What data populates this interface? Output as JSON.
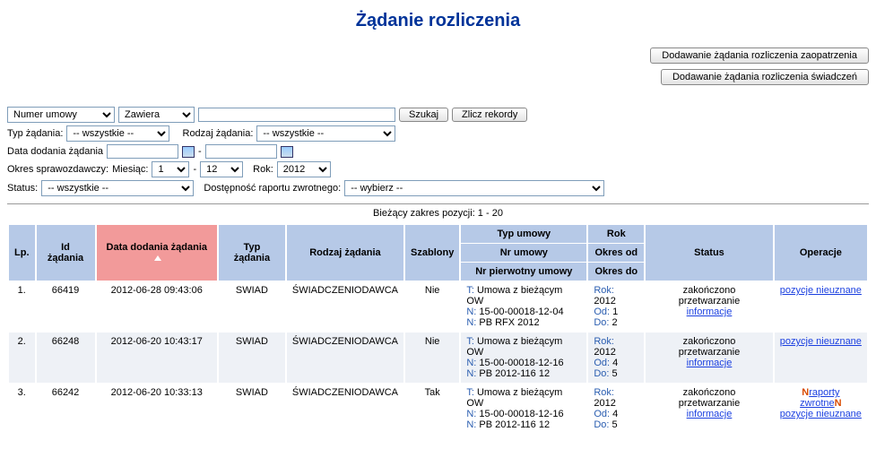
{
  "title": "Żądanie rozliczenia",
  "buttons": {
    "add_supply": "Dodawanie żądania rozliczenia zaopatrzenia",
    "add_service": "Dodawanie żądania rozliczenia świadczeń",
    "search": "Szukaj",
    "count": "Zlicz rekordy"
  },
  "filters": {
    "field_selector": "Numer umowy",
    "match_selector": "Zawiera",
    "search_value": "",
    "type_label": "Typ żądania:",
    "type_value": "-- wszystkie --",
    "kind_label": "Rodzaj żądania:",
    "kind_value": "-- wszystkie --",
    "date_added_label": "Data dodania żądania",
    "date_from": "",
    "date_to": "",
    "period_label": "Okres sprawozdawczy:",
    "month_label": "Miesiąc:",
    "month_from": "1",
    "month_to": "12",
    "year_label": "Rok:",
    "year_value": "2012",
    "status_label": "Status:",
    "status_value": "-- wszystkie --",
    "report_avail_label": "Dostępność raportu zwrotnego:",
    "report_avail_value": "-- wybierz --"
  },
  "range_text": "Bieżący zakres pozycji: 1 - 20",
  "headers": {
    "lp": "Lp.",
    "id": "Id żądania",
    "date_added": "Data dodania żądania",
    "type": "Typ żądania",
    "kind": "Rodzaj żądania",
    "templates": "Szablony",
    "agr_type": "Typ umowy",
    "agr_no": "Nr umowy",
    "agr_primary": "Nr pierwotny umowy",
    "year": "Rok",
    "period_from": "Okres od",
    "period_to": "Okres do",
    "status": "Status",
    "ops": "Operacje"
  },
  "labels": {
    "T": "T:",
    "N": "N:",
    "Rok": "Rok:",
    "Od": "Od:",
    "Do": "Do:"
  },
  "rows": [
    {
      "lp": "1.",
      "id": "66419",
      "date": "2012-06-28 09:43:06",
      "type": "SWIAD",
      "kind": "ŚWIADCZENIODAWCA",
      "templates": "Nie",
      "agr_t": "Umowa z bieżącym OW",
      "agr_n1": "15-00-00018-12-04",
      "agr_n2": "PB RFX 2012",
      "rok": "2012",
      "od": "1",
      "do": "2",
      "status1": "zakończono przetwarzanie",
      "status_link": "informacje",
      "ops": [
        {
          "text": "pozycje nieuznane",
          "new": false
        }
      ]
    },
    {
      "lp": "2.",
      "id": "66248",
      "date": "2012-06-20 10:43:17",
      "type": "SWIAD",
      "kind": "ŚWIADCZENIODAWCA",
      "templates": "Nie",
      "agr_t": "Umowa z bieżącym OW",
      "agr_n1": "15-00-00018-12-16",
      "agr_n2": "PB 2012-116 12",
      "rok": "2012",
      "od": "4",
      "do": "5",
      "status1": "zakończono przetwarzanie",
      "status_link": "informacje",
      "ops": [
        {
          "text": "pozycje nieuznane",
          "new": false
        }
      ]
    },
    {
      "lp": "3.",
      "id": "66242",
      "date": "2012-06-20 10:33:13",
      "type": "SWIAD",
      "kind": "ŚWIADCZENIODAWCA",
      "templates": "Tak",
      "agr_t": "Umowa z bieżącym OW",
      "agr_n1": "15-00-00018-12-16",
      "agr_n2": "PB 2012-116 12",
      "rok": "2012",
      "od": "4",
      "do": "5",
      "status1": "zakończono przetwarzanie",
      "status_link": "informacje",
      "ops": [
        {
          "text": "raporty zwrotne",
          "new": true
        },
        {
          "text": "pozycje nieuznane",
          "new": false
        }
      ]
    }
  ]
}
